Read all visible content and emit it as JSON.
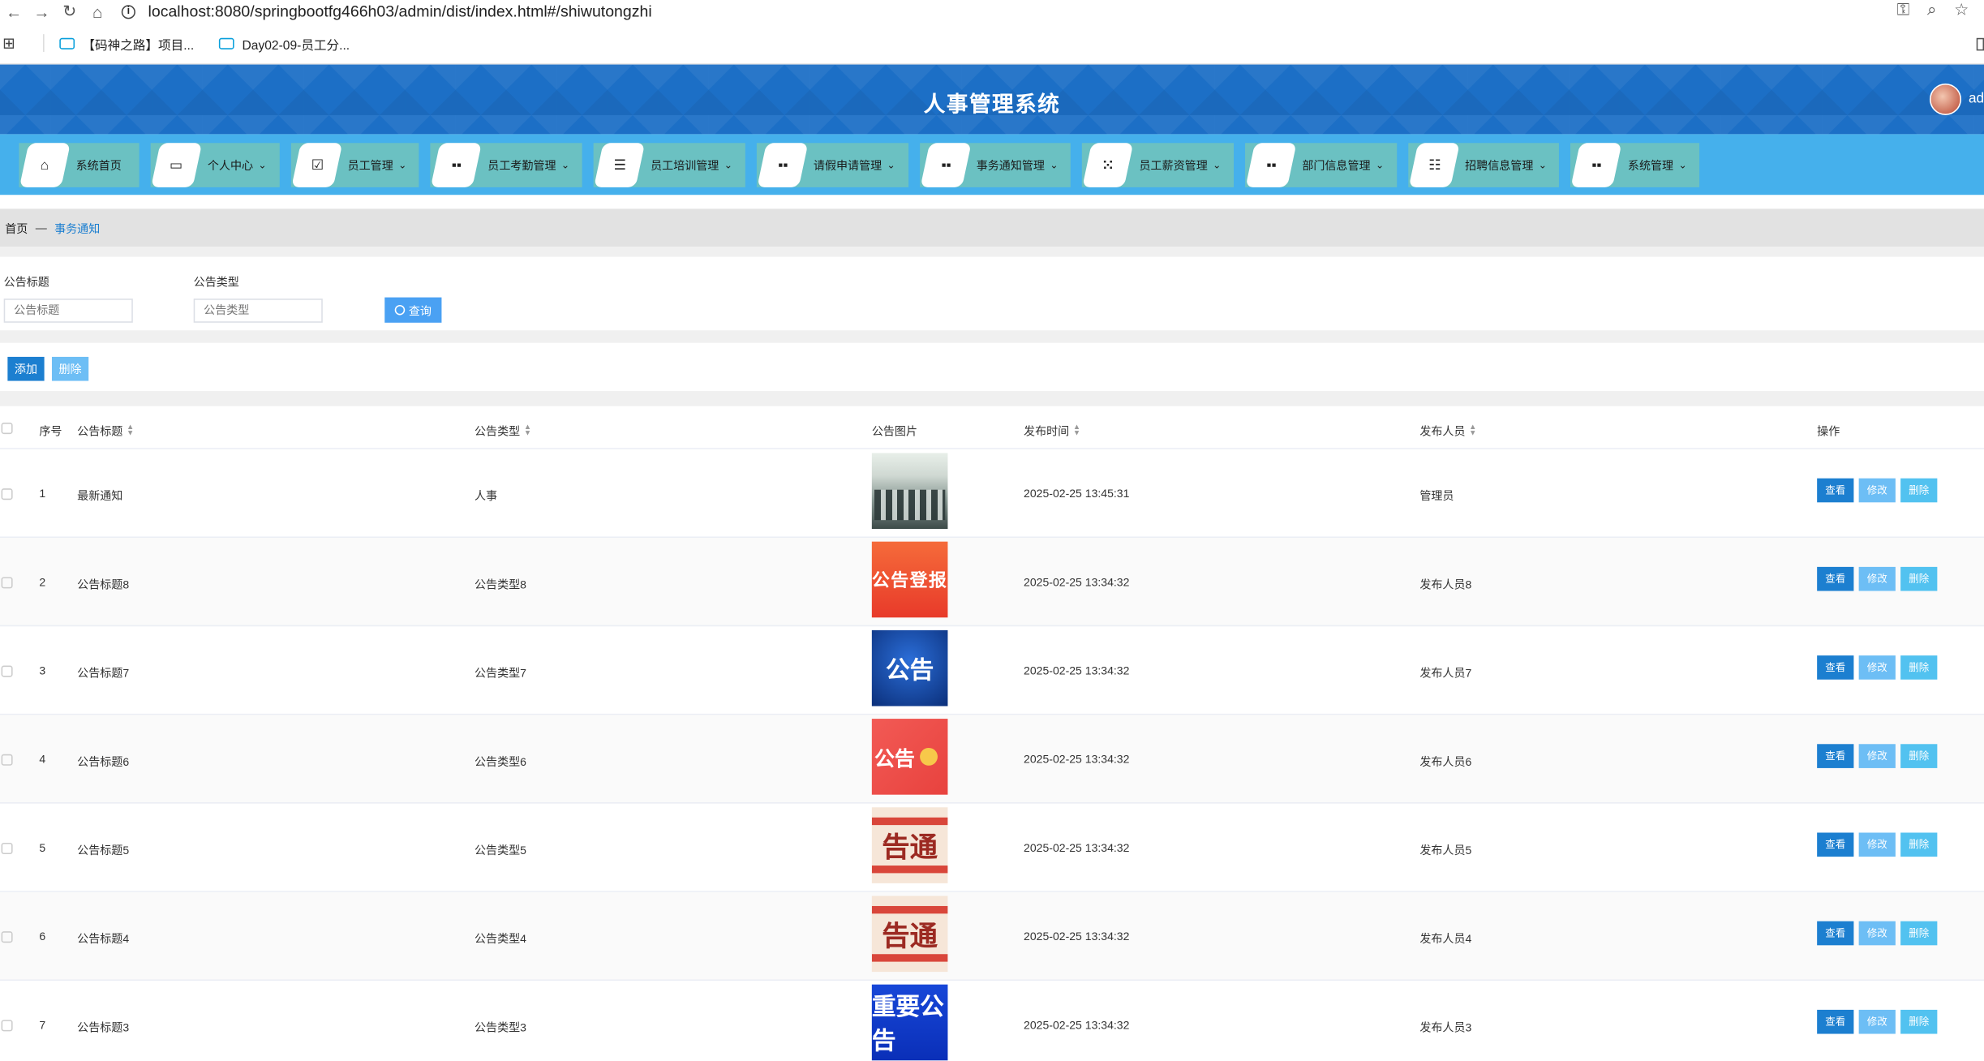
{
  "browser": {
    "url": "localhost:8080/springbootfg466h03/admin/dist/index.html#/shiwutongzhi",
    "bookmarks": [
      "【码神之路】项目...",
      "Day02-09-员工分..."
    ]
  },
  "header": {
    "title": "人事管理系统",
    "user": "ad"
  },
  "menu": [
    {
      "label": "系统首页",
      "icon": "home-icon",
      "glyph": "⌂",
      "caret": ""
    },
    {
      "label": "个人中心",
      "icon": "window-icon",
      "glyph": "▭",
      "caret": "⌄"
    },
    {
      "label": "员工管理",
      "icon": "check-square-icon",
      "glyph": "☑",
      "caret": "⌄"
    },
    {
      "label": "员工考勤管理",
      "icon": "grid-icon",
      "glyph": "▪▪",
      "caret": "⌄"
    },
    {
      "label": "员工培训管理",
      "icon": "list-icon",
      "glyph": "☰",
      "caret": "⌄"
    },
    {
      "label": "请假申请管理",
      "icon": "grid-icon",
      "glyph": "▪▪",
      "caret": "⌄"
    },
    {
      "label": "事务通知管理",
      "icon": "grid-icon",
      "glyph": "▪▪",
      "caret": "⌄"
    },
    {
      "label": "员工薪资管理",
      "icon": "grid-dots-icon",
      "glyph": "⁙",
      "caret": "⌄"
    },
    {
      "label": "部门信息管理",
      "icon": "grid-icon",
      "glyph": "▪▪",
      "caret": "⌄"
    },
    {
      "label": "招聘信息管理",
      "icon": "sliders-icon",
      "glyph": "☷",
      "caret": "⌄"
    },
    {
      "label": "系统管理",
      "icon": "grid-icon",
      "glyph": "▪▪",
      "caret": "⌄"
    }
  ],
  "breadcrumb": {
    "home": "首页",
    "sep": "—",
    "current": "事务通知"
  },
  "search": {
    "title_label": "公告标题",
    "title_placeholder": "公告标题",
    "type_label": "公告类型",
    "type_placeholder": "公告类型",
    "button": "查询"
  },
  "actions": {
    "add": "添加",
    "delete": "删除"
  },
  "table": {
    "headers": {
      "index": "序号",
      "title": "公告标题",
      "type": "公告类型",
      "image": "公告图片",
      "time": "发布时间",
      "publisher": "发布人员",
      "ops": "操作"
    },
    "rows": [
      {
        "index": "1",
        "title": "最新通知",
        "type": "人事",
        "img": "office",
        "img_text": "",
        "time": "2025-02-25 13:45:31",
        "publisher": "管理员"
      },
      {
        "index": "2",
        "title": "公告标题8",
        "type": "公告类型8",
        "img": "orange",
        "img_text": "公告登报",
        "time": "2025-02-25 13:34:32",
        "publisher": "发布人员8"
      },
      {
        "index": "3",
        "title": "公告标题7",
        "type": "公告类型7",
        "img": "blue",
        "img_text": "公告",
        "time": "2025-02-25 13:34:32",
        "publisher": "发布人员7"
      },
      {
        "index": "4",
        "title": "公告标题6",
        "type": "公告类型6",
        "img": "red",
        "img_text": "公告",
        "time": "2025-02-25 13:34:32",
        "publisher": "发布人员6"
      },
      {
        "index": "5",
        "title": "公告标题5",
        "type": "公告类型5",
        "img": "cream",
        "img_text": "告通",
        "time": "2025-02-25 13:34:32",
        "publisher": "发布人员5"
      },
      {
        "index": "6",
        "title": "公告标题4",
        "type": "公告类型4",
        "img": "cream",
        "img_text": "告通",
        "time": "2025-02-25 13:34:32",
        "publisher": "发布人员4"
      },
      {
        "index": "7",
        "title": "公告标题3",
        "type": "公告类型3",
        "img": "deepblue",
        "img_text": "重要公告",
        "time": "2025-02-25 13:34:32",
        "publisher": "发布人员3"
      }
    ],
    "ops": {
      "view": "查看",
      "edit": "修改",
      "delete": "删除"
    }
  }
}
